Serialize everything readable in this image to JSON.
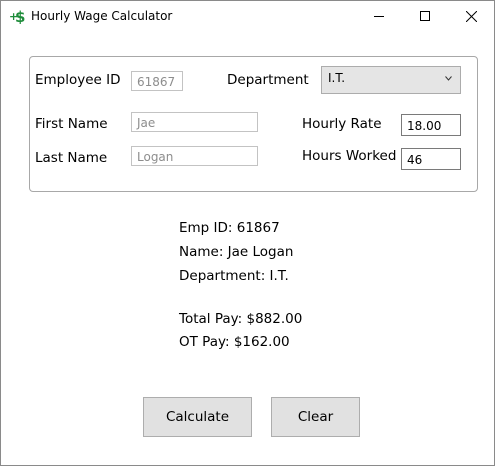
{
  "window": {
    "title": "Hourly Wage Calculator",
    "icon": "dollar-plus-icon"
  },
  "form": {
    "employee_id_label": "Employee ID",
    "employee_id_value": "61867",
    "department_label": "Department",
    "department_value": "I.T.",
    "first_name_label": "First Name",
    "first_name_value": "Jae",
    "last_name_label": "Last Name",
    "last_name_value": "Logan",
    "hourly_rate_label": "Hourly Rate",
    "hourly_rate_value": "18.00",
    "hours_worked_label": "Hours Worked",
    "hours_worked_value": "46"
  },
  "output": {
    "emp_id": "Emp ID: 61867",
    "name": "Name: Jae Logan",
    "department": "Department: I.T.",
    "total_pay": "Total Pay: $882.00",
    "ot_pay": "OT Pay: $162.00"
  },
  "buttons": {
    "calculate": "Calculate",
    "clear": "Clear"
  },
  "colors": {
    "icon_green": "#1e8c3a",
    "button_bg": "#e1e1e1",
    "combo_bg": "#e5e5e5"
  }
}
